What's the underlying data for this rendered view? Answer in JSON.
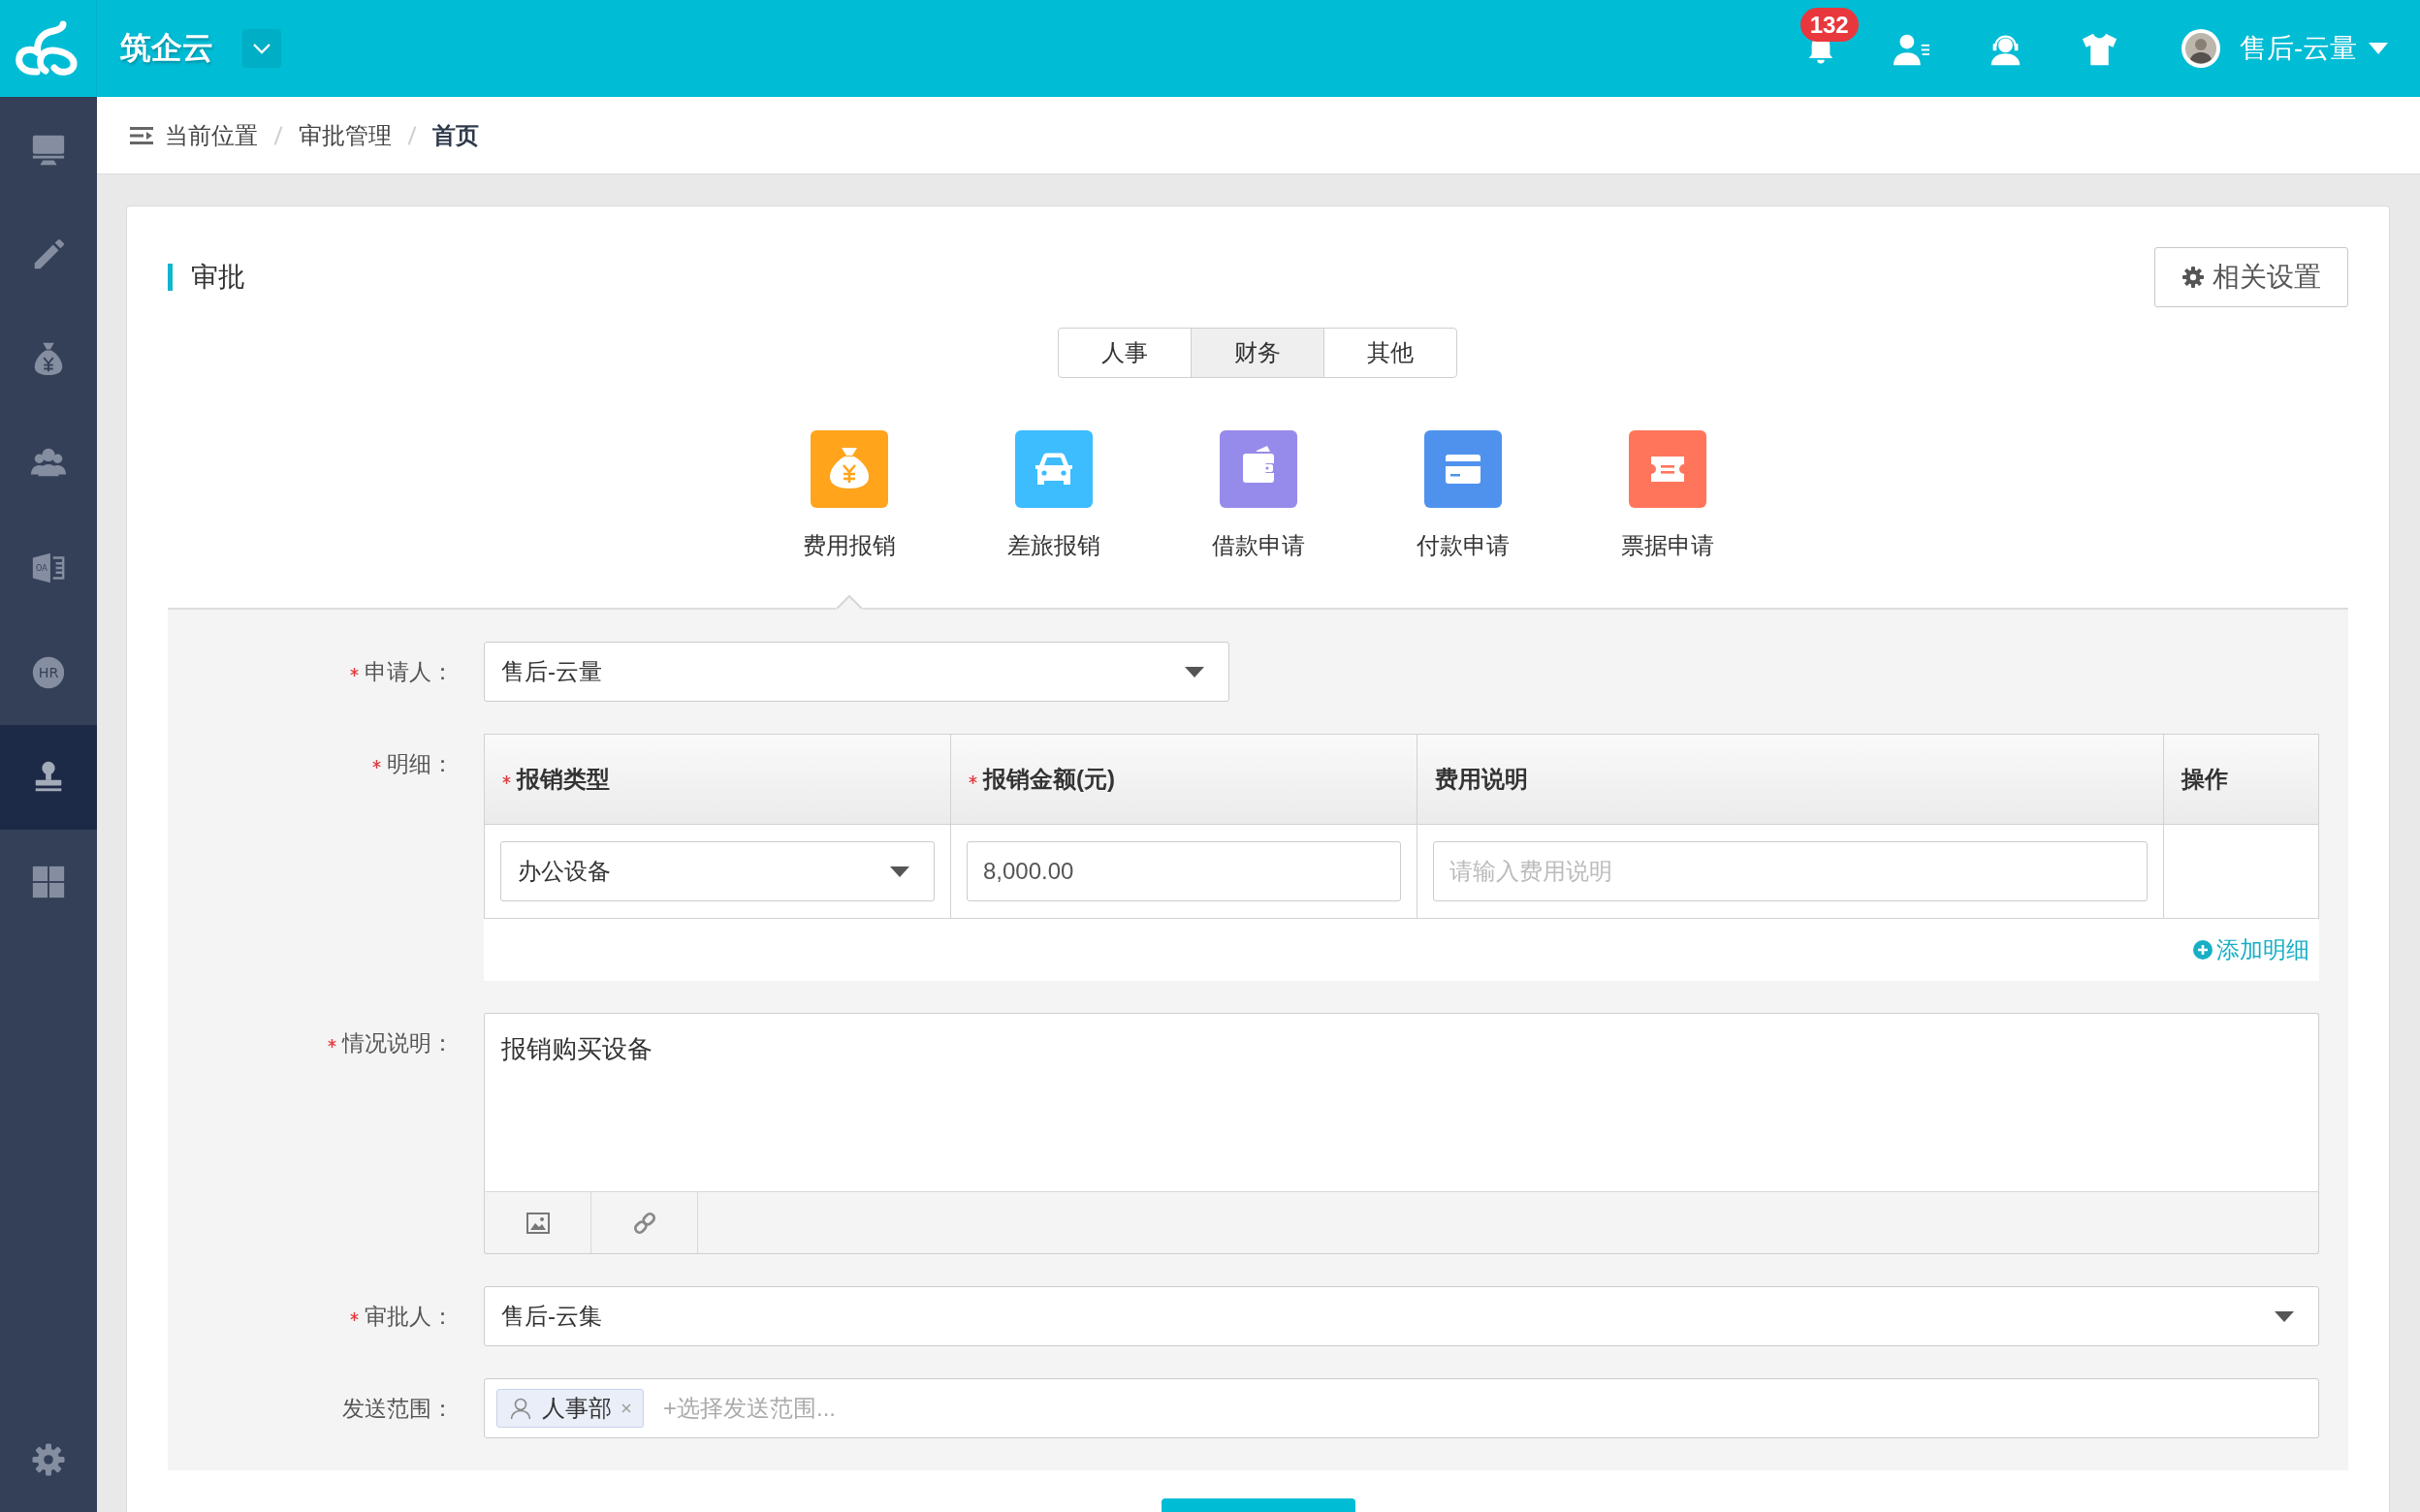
{
  "top_bar": {
    "brand": "筑企云",
    "notification_count": "132",
    "user_name": "售后-云量"
  },
  "sidebar": {
    "items": [
      {
        "selected": false
      },
      {
        "selected": false
      },
      {
        "selected": false
      },
      {
        "selected": false
      },
      {
        "selected": false,
        "icon_text": "OA"
      },
      {
        "selected": false,
        "icon_text": "HR"
      },
      {
        "selected": true
      },
      {
        "selected": false
      }
    ]
  },
  "breadcrumb": {
    "prefix": "当前位置",
    "items": [
      {
        "label": "审批管理",
        "current": false
      },
      {
        "label": "首页",
        "current": true
      }
    ]
  },
  "card": {
    "title": "审批",
    "settings_button": "相关设置"
  },
  "tabs": [
    {
      "label": "人事",
      "selected": false
    },
    {
      "label": "财务",
      "selected": true
    },
    {
      "label": "其他",
      "selected": false
    }
  ],
  "apps": [
    {
      "label": "费用报销",
      "color": "#ffa41b",
      "selected": true
    },
    {
      "label": "差旅报销",
      "color": "#3dbcfe",
      "selected": false
    },
    {
      "label": "借款申请",
      "color": "#968bea",
      "selected": false
    },
    {
      "label": "付款申请",
      "color": "#4f92ee",
      "selected": false
    },
    {
      "label": "票据申请",
      "color": "#ff755b",
      "selected": false
    }
  ],
  "form": {
    "fields": [
      {
        "kind": "select",
        "label": "申请人：",
        "required": true,
        "value": "售后-云量"
      },
      {
        "kind": "detail_table",
        "label": "明细：",
        "required": true,
        "columns": [
          {
            "label": "报销类型",
            "required": true
          },
          {
            "label": "报销金额(元)",
            "required": true
          },
          {
            "label": "费用说明",
            "required": false
          },
          {
            "label": "操作",
            "required": false
          }
        ],
        "rows": [
          {
            "cells": [
              {
                "kind": "select",
                "value": "办公设备"
              },
              {
                "kind": "input",
                "value": "8,000.00"
              },
              {
                "kind": "input",
                "placeholder": "请输入费用说明"
              }
            ]
          }
        ],
        "add_link": "添加明细"
      },
      {
        "kind": "rich_text",
        "label": "情况说明：",
        "required": true,
        "value": "报销购买设备"
      },
      {
        "kind": "select",
        "label": "审批人：",
        "required": true,
        "value": "售后-云集"
      },
      {
        "kind": "tag_picker",
        "label": "发送范围：",
        "required": false,
        "tags": [
          {
            "label": "人事部"
          }
        ],
        "placeholder": "+选择发送范围..."
      }
    ]
  }
}
